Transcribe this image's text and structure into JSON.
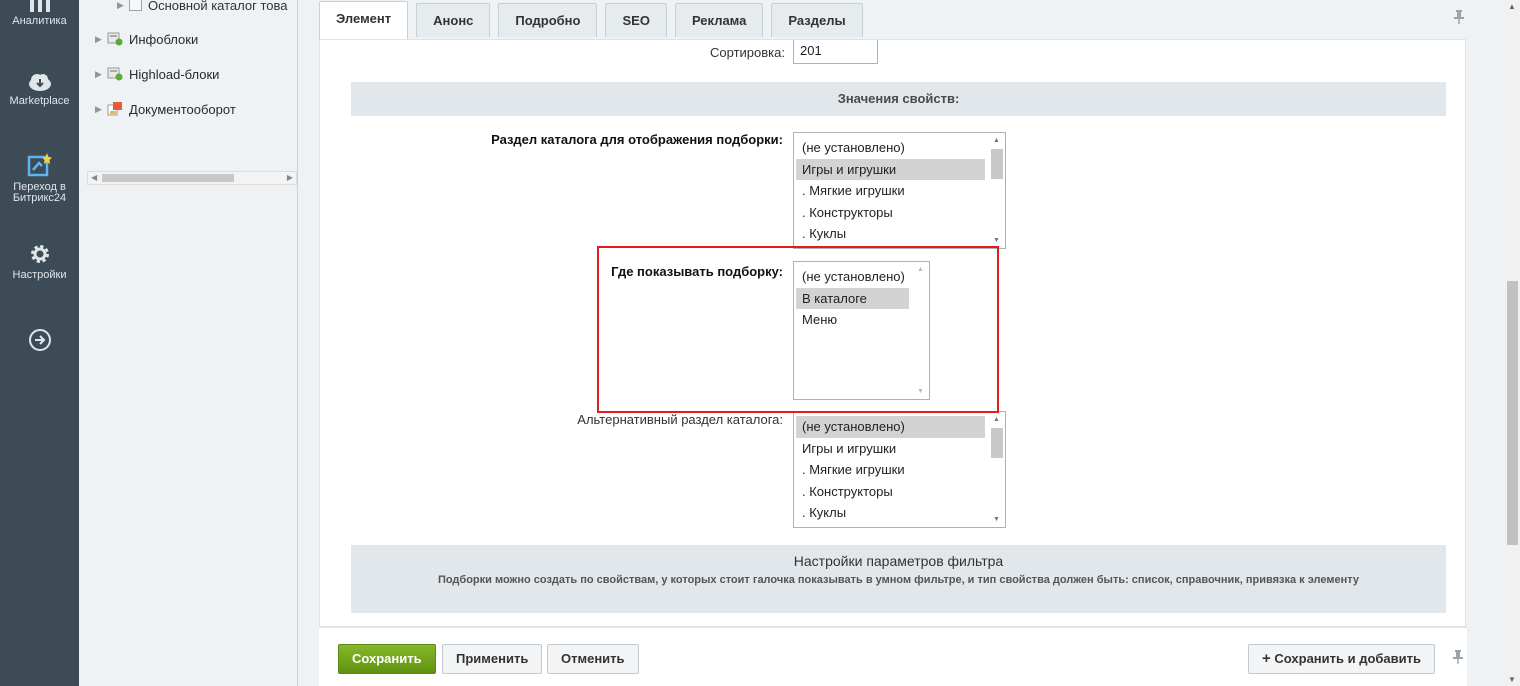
{
  "leftbar": {
    "items": [
      {
        "label": "Аналитика",
        "icon": "bar-chart-icon"
      },
      {
        "label": "Marketplace",
        "icon": "cloud-download-icon"
      },
      {
        "label": "Переход в Битрикс24",
        "icon": "bitrix24-star-icon"
      },
      {
        "label": "Настройки",
        "icon": "gear-icon"
      },
      {
        "label": "",
        "icon": "arrow-right-circle-icon"
      }
    ]
  },
  "tree": {
    "items": [
      {
        "label": "Основной каталог това",
        "icon": "catalog-icon"
      },
      {
        "label": "Инфоблоки",
        "icon": "infoblock-icon"
      },
      {
        "label": "Highload-блоки",
        "icon": "infoblock-icon"
      },
      {
        "label": "Документооборот",
        "icon": "document-flow-icon"
      }
    ]
  },
  "tabs": [
    "Элемент",
    "Анонс",
    "Подробно",
    "SEO",
    "Реклама",
    "Разделы"
  ],
  "form": {
    "sort_label": "Сортировка:",
    "sort_value": "201",
    "properties_header": "Значения свойств:",
    "section_label": "Раздел каталога для отображения подборки:",
    "section_options": [
      "(не установлено)",
      "Игры и игрушки",
      ". Мягкие игрушки",
      ". Конструкторы",
      ". Куклы"
    ],
    "where_label": "Где показывать подборку:",
    "where_options": [
      "(не установлено)",
      "В каталоге",
      "Меню"
    ],
    "alt_label": "Альтернативный раздел каталога:",
    "alt_options": [
      "(не установлено)",
      "Игры и игрушки",
      ". Мягкие игрушки",
      ". Конструкторы",
      ". Куклы"
    ],
    "filter_title": "Настройки параметров фильтра",
    "filter_desc": "Подборки можно создать по свойствам, у которых стоит галочка показывать в умном фильтре, и тип свойства должен быть: список, справочник, привязка к элементу"
  },
  "buttons": {
    "save": "Сохранить",
    "apply": "Применить",
    "cancel": "Отменить",
    "save_add": "Сохранить и добавить"
  },
  "colors": {
    "save_green": "#6a9e1e",
    "highlight_red": "#e01c1c",
    "sidebar_dark": "#3d4b57"
  }
}
